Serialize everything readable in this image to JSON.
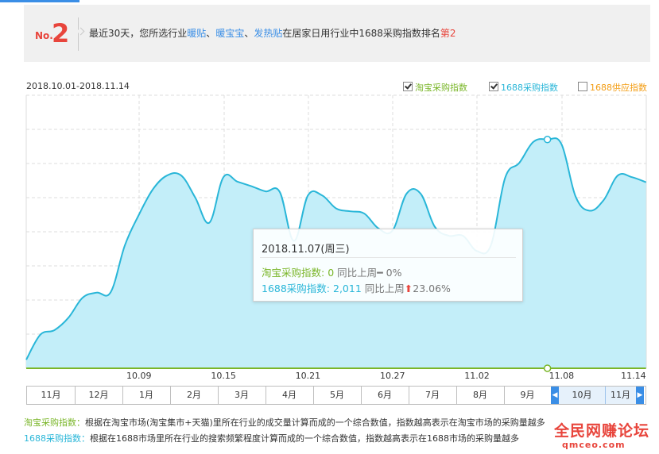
{
  "banner": {
    "rank_prefix": "No.",
    "rank_number": "2",
    "text_before": "最近30天，您所选行业",
    "keywords": [
      "暖贴",
      "暖宝宝",
      "发热贴"
    ],
    "sep1": "、",
    "sep2": "、",
    "text_middle": "在居家日用行业中1688采购指数排名",
    "rank_text": "第2"
  },
  "chart_header": {
    "date_range": "2018.10.01-2018.11.14"
  },
  "legend": [
    {
      "label": "淘宝采购指数",
      "checked": true,
      "color": "#7ab629"
    },
    {
      "label": "1688采购指数",
      "checked": true,
      "color": "#29b6d8"
    },
    {
      "label": "1688供应指数",
      "checked": false,
      "color": "#f39c12"
    }
  ],
  "chart_data": {
    "type": "area",
    "title": "",
    "xlabel": "",
    "ylabel": "",
    "x_ticks": [
      "10.09",
      "10.15",
      "10.21",
      "10.27",
      "11.02",
      "11.08",
      "11.14"
    ],
    "x": [
      "10.01",
      "10.02",
      "10.03",
      "10.04",
      "10.05",
      "10.06",
      "10.07",
      "10.08",
      "10.09",
      "10.10",
      "10.11",
      "10.12",
      "10.13",
      "10.14",
      "10.15",
      "10.16",
      "10.17",
      "10.18",
      "10.19",
      "10.20",
      "10.21",
      "10.22",
      "10.23",
      "10.24",
      "10.25",
      "10.26",
      "10.27",
      "10.28",
      "10.29",
      "10.30",
      "10.31",
      "11.01",
      "11.02",
      "11.03",
      "11.04",
      "11.05",
      "11.06",
      "11.07",
      "11.08",
      "11.09",
      "11.10",
      "11.11",
      "11.12",
      "11.13",
      "11.14"
    ],
    "ylim": [
      0,
      2400
    ],
    "grid": true,
    "series": [
      {
        "name": "1688采购指数",
        "color": "#29b6d8",
        "values": [
          75,
          295,
          335,
          445,
          620,
          665,
          670,
          1080,
          1350,
          1575,
          1695,
          1695,
          1500,
          1280,
          1680,
          1640,
          1600,
          1555,
          1550,
          1120,
          1520,
          1520,
          1405,
          1380,
          1360,
          1230,
          1210,
          1535,
          1535,
          1245,
          1165,
          1165,
          1030,
          1085,
          1675,
          1805,
          1990,
          2011,
          1970,
          1510,
          1385,
          1480,
          1695,
          1680,
          1635
        ]
      },
      {
        "name": "淘宝采购指数",
        "color": "#7ab629",
        "values": [
          0,
          0,
          0,
          0,
          0,
          0,
          0,
          0,
          0,
          0,
          0,
          0,
          0,
          0,
          0,
          0,
          0,
          0,
          0,
          0,
          0,
          0,
          0,
          0,
          0,
          0,
          0,
          0,
          0,
          0,
          0,
          0,
          0,
          0,
          0,
          0,
          0,
          0,
          0,
          0,
          0,
          0,
          0,
          0,
          0
        ]
      }
    ],
    "highlight_index": 37
  },
  "tooltip": {
    "title": "2018.11.07(周三)",
    "rows": [
      {
        "label": "淘宝采购指数: ",
        "value": "0",
        "compare": " 同比上周",
        "dir_symbol": "━",
        "change": " 0%"
      },
      {
        "label": "1688采购指数: ",
        "value": "2,011",
        "compare": " 同比上周",
        "dir_symbol": "⬆",
        "change": "23.06%"
      }
    ]
  },
  "navigator": {
    "months": [
      "11月",
      "12月",
      "1月",
      "2月",
      "3月",
      "4月",
      "5月",
      "6月",
      "7月",
      "8月",
      "9月",
      "10月",
      "11月"
    ],
    "left_handle": "◀",
    "right_handle": "▶"
  },
  "footnotes": [
    {
      "label": "淘宝采购指数：",
      "text": "根据在淘宝市场(淘宝集市+天猫)里所在行业的成交量计算而成的一个综合数值，指数越高表示在淘宝市场的采购量越多"
    },
    {
      "label": "1688采购指数：",
      "text": "根据在1688市场里所在行业的搜索频繁程度计算而成的一个综合数值，指数越高表示在1688市场的采购量越多"
    }
  ],
  "watermark": {
    "title": "全民网赚论坛",
    "url": "qmceo.com"
  }
}
